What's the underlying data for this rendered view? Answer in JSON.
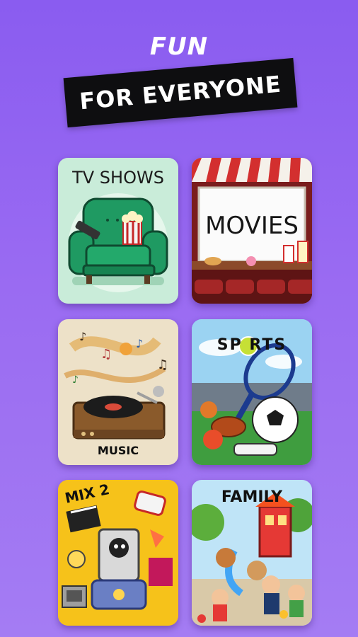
{
  "header": {
    "headline": "FUN",
    "banner": "FOR EVERYONE"
  },
  "categories": [
    {
      "label": "TV SHOWS"
    },
    {
      "label": "MOVIES"
    },
    {
      "label": "MUSIC"
    },
    {
      "label": "SP  RTS"
    },
    {
      "label": "MIX 2"
    },
    {
      "label": "FAMILY"
    }
  ],
  "colors": {
    "background_top": "#8a5cf0",
    "background_bottom": "#a47cf3",
    "banner": "#0e0e10"
  }
}
